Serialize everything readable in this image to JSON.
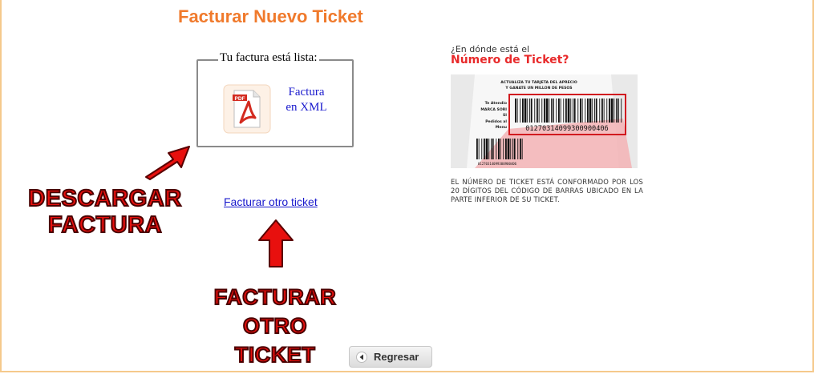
{
  "page": {
    "title": "Facturar Nuevo Ticket"
  },
  "download_box": {
    "legend": "Tu factura está lista:",
    "pdf_icon_label": "PDF",
    "xml_link_line1": "Factura",
    "xml_link_line2": "en XML"
  },
  "links": {
    "facturar_otro": "Facturar otro ticket"
  },
  "annotations": {
    "descargar_line1": "DESCARGAR",
    "descargar_line2": "FACTURA",
    "facturar_line1": "FACTURAR",
    "facturar_line2": "OTRO",
    "facturar_line3": "TICKET"
  },
  "buttons": {
    "regresar": "Regresar"
  },
  "help": {
    "question": "¿En dónde está el",
    "title": "Número de Ticket?",
    "ticket_header_line1": "ACTUALIZA TU TARJETA DEL APRECIO",
    "ticket_header_line2": "Y GANATE UN MILLON DE PESOS",
    "ticket_lines": [
      "Te Atendio",
      "MARCA SORI",
      "SI",
      "Pedidos al",
      "Menu"
    ],
    "ticket_number": "01270314099300900406",
    "ticket_number_small": "01270314099300900406",
    "description": "EL NÚMERO DE TICKET ESTÁ CONFORMADO POR LOS 20 DÍGITOS DEL CÓDIGO DE BARRAS UBICADO EN LA PARTE INFERIOR DE SU TICKET."
  },
  "colors": {
    "title_orange": "#f07a2c",
    "frame_border": "#f5c98c",
    "link_blue": "#1a1acd",
    "annotation_red": "#e8100e",
    "help_red": "#e8292a"
  }
}
